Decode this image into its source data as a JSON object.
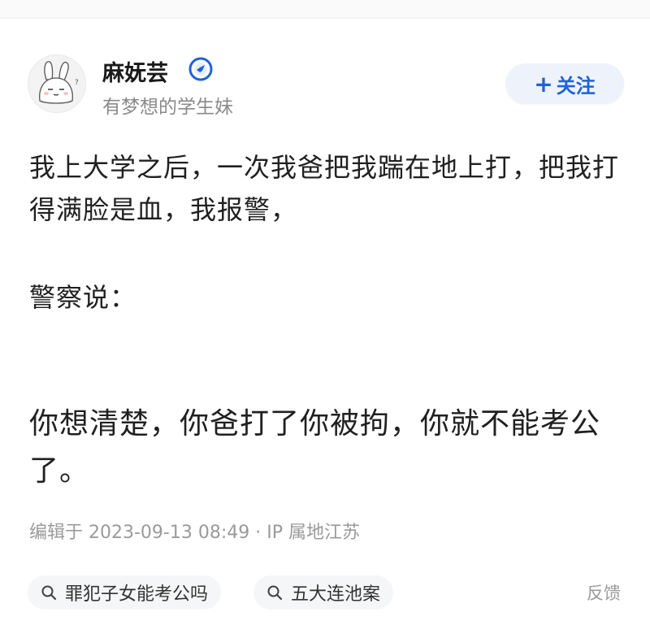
{
  "author": {
    "name": "麻妩芸",
    "bio": "有梦想的学生妹",
    "avatar_icon": "bunny-avatar-icon",
    "verified_icon": "verified-badge-icon"
  },
  "follow_button": {
    "label": "关注",
    "icon": "plus-icon",
    "color": "#1e62d8"
  },
  "post": {
    "paragraph_1": "我上大学之后，一次我爸把我踹在地上打，把我打得满脸是血，我报警，",
    "paragraph_2": "警察说：",
    "paragraph_3": "你想清楚，你爸打了你被拘，你就不能考公了。"
  },
  "meta": {
    "edited": "编辑于 2023-09-13 08:49 · IP 属地江苏"
  },
  "tags": [
    {
      "label": "罪犯子女能考公吗",
      "icon": "search-icon"
    },
    {
      "label": "五大连池案",
      "icon": "search-icon"
    }
  ],
  "feedback_label": "反馈"
}
